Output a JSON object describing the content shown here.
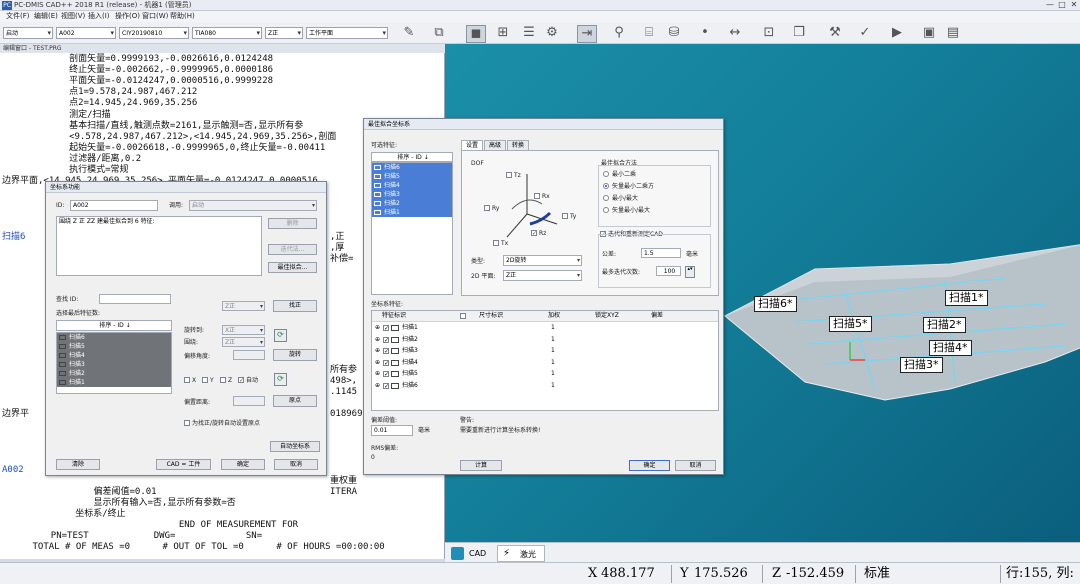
{
  "app": {
    "title": "PC-DMIS CAD++ 2018 R1 (release) - 机器1 (管理员)",
    "logo_text": "PC",
    "window_controls": [
      "—",
      "□",
      "✕"
    ]
  },
  "menu": [
    "文件(F)",
    "编辑(E)",
    "视图(V)",
    "插入(I)",
    "操作(O)",
    "窗口(W)",
    "帮助(H)"
  ],
  "toolbar": {
    "combos": [
      "启动",
      "A002",
      "CIY20190810",
      "TIA080",
      "Z正",
      "工作平面"
    ],
    "icons": [
      "probe-icon",
      "cube-wire-icon",
      "cube-solid-icon",
      "crosshair-icon",
      "comment-icon",
      "gears-icon",
      "execute-icon",
      "tree-icon",
      "cylinder-icon",
      "point-icon",
      "dimension-icon",
      "gauge-icon",
      "window-icon",
      "wrench-icon",
      "check-icon",
      "play-icon",
      "report-icon",
      "report2-icon"
    ]
  },
  "editor": {
    "caption": "编辑窗口 - TEST.PRG",
    "lines": [
      {
        "indent": 11,
        "text": "剖面矢量=0.9999193,-0.0026616,0.0124248",
        "blue": false
      },
      {
        "indent": 11,
        "text": "终止矢量=-0.002662,-0.9999965,0.0000186",
        "blue": false
      },
      {
        "indent": 11,
        "text": "平面矢量=-0.0124247,0.0000516,0.9999228",
        "blue": false
      },
      {
        "indent": 11,
        "text": "点1=9.578,24.987,467.212",
        "blue": false
      },
      {
        "indent": 11,
        "text": "点2=14.945,24.969,35.256",
        "blue": false
      },
      {
        "indent": 11,
        "text": "测定/扫描",
        "blue": false
      },
      {
        "indent": 11,
        "text": "基本扫描/直线,触测点数=2161,显示触测=否,显示所有参",
        "blue": false
      },
      {
        "indent": 11,
        "text": "<9.578,24.987,467.212>,<14.945,24.969,35.256>,剖面",
        "blue": false
      },
      {
        "indent": 11,
        "text": "起始矢量=-0.0026618,-0.9999965,0,终止矢量=-0.00411",
        "blue": false
      },
      {
        "indent": 11,
        "text": "过滤器/距离,0.2",
        "blue": false
      },
      {
        "indent": 11,
        "text": "执行模式=常规",
        "blue": false
      },
      {
        "indent": 0,
        "text": "边界平面,<14.945,24.969,35.256>,平面矢量=-0.0124247,0.0000516,",
        "blue": false
      }
    ],
    "side_labels": [
      {
        "text": "扫描6",
        "blue": true,
        "line": 16
      },
      {
        "text": "边界平",
        "blue": false,
        "line": 32
      },
      {
        "text": "A002",
        "blue": true,
        "line": 37
      }
    ],
    "right_fragments": [
      {
        "text": ",正",
        "line": 16
      },
      {
        "text": ",厚",
        "line": 17
      },
      {
        "text": "补偿=",
        "line": 18
      },
      {
        "text": "所有参",
        "line": 28
      },
      {
        "text": "498>,",
        "line": 29
      },
      {
        "text": ".1145",
        "line": 30
      },
      {
        "text": "018969",
        "line": 32
      },
      {
        "text": "重权重",
        "line": 38
      },
      {
        "text": "ITERA",
        "line": 39
      }
    ],
    "tail_lines": [
      {
        "indent": 15,
        "text": "偏差阈值=0.01"
      },
      {
        "indent": 15,
        "text": "显示所有输入=否,显示所有参数=否"
      },
      {
        "indent": 12,
        "text": "坐标系/终止"
      },
      {
        "indent": 29,
        "text": "END OF MEASUREMENT FOR"
      },
      {
        "indent": 8,
        "text": "PN=TEST            DWG=             SN="
      },
      {
        "indent": 5,
        "text": "TOTAL # OF MEAS =0      # OUT OF TOL =0      # OF HOURS =00:00:00"
      }
    ]
  },
  "viewport": {
    "labels": [
      "扫描6*",
      "扫描1*",
      "扫描5*",
      "扫描2*",
      "扫描4*",
      "扫描3*"
    ]
  },
  "bottom_tabs": [
    "CAD",
    "激光"
  ],
  "status": {
    "x_label": "X",
    "x_value": "488.177",
    "y_label": "Y",
    "y_value": "175.526",
    "z_label": "Z",
    "z_value": "-152.459",
    "mode": "标准",
    "rowcol": "行:155, 列:"
  },
  "align_dialog": {
    "title": "坐标系功能",
    "id_label": "ID:",
    "id_value": "A002",
    "recall_label": "调用:",
    "recall_value": "启动",
    "text_area": "围绕 Z 正 ZZ 建最佳拟合到 6 特征:",
    "btn_delete": "删除",
    "btn_iterate": "迭代法...",
    "btn_bestfit": "最佳拟合...",
    "find_id_label": "查找 ID:",
    "select_label": "选择最后特征数:",
    "sort_label": "排序 - ID ↓",
    "features": [
      "扫描6",
      "扫描5",
      "扫描4",
      "扫描3",
      "扫描2",
      "扫描1"
    ],
    "level_combo": "Z正",
    "level_button": "找正",
    "rotate_label": "旋转到:",
    "rotate_combo": "X正",
    "around_label": "围绕:",
    "around_combo": "Z正",
    "offset_label": "偏移角度:",
    "rotate_button": "旋转",
    "axis_labels": [
      "X",
      "Y",
      "Z"
    ],
    "auto_label": "自动",
    "offset_dist_label": "偏置距离:",
    "origin_button": "原点",
    "autoset_label": "为找正/旋转自动设置原点",
    "btn_autoalign": "自动坐标系",
    "btn_clear": "清除",
    "btn_cad": "CAD = 工件",
    "btn_ok": "确定",
    "btn_cancel": "取消"
  },
  "bestfit_dialog": {
    "title": "最佳拟合坐标系",
    "avail_label": "可选特征:",
    "sort_label": "排序 - ID ↓",
    "features": [
      "扫描6",
      "扫描5",
      "扫描4",
      "扫描3",
      "扫描2",
      "扫描1"
    ],
    "tabs": [
      "设置",
      "高级",
      "转换"
    ],
    "dof_label": "DOF",
    "dof_axes": [
      "Tz",
      "Rx",
      "Ry",
      "Ty",
      "Rz",
      "Tx"
    ],
    "type_label": "类型:",
    "type_value": "2D旋转",
    "plane_label": "2D 平面:",
    "plane_value": "Z正",
    "method_label": "最佳拟合方法",
    "methods": [
      "最小二乘",
      "矢量最小二乘方",
      "最小/最大",
      "矢量最小/最大"
    ],
    "method_selected": 1,
    "iterate_cad_label": "迭代和重新测定CAD",
    "tol_label": "公差:",
    "tol_value": "1.5",
    "tol_unit": "毫米",
    "maxiter_label": "最多迭代次数:",
    "maxiter_value": "100",
    "coord_feat_label": "坐标系特征:",
    "col_headers": [
      "特征标识",
      "尺寸标识",
      "加权",
      "锁定XYZ",
      "偏差"
    ],
    "rows": [
      {
        "name": "扫描1",
        "weight": "1"
      },
      {
        "name": "扫描2",
        "weight": "1"
      },
      {
        "name": "扫描3",
        "weight": "1"
      },
      {
        "name": "扫描4",
        "weight": "1"
      },
      {
        "name": "扫描5",
        "weight": "1"
      },
      {
        "name": "扫描6",
        "weight": "1"
      }
    ],
    "threshold_label": "偏差阈值:",
    "threshold_value": "0.01",
    "threshold_unit": "毫米",
    "warning_label": "警告:",
    "warning_text": "需要重新进行计算坐标系转换!",
    "rms_label": "RMS偏差:",
    "rms_value": "0",
    "btn_calc": "计算",
    "btn_ok": "确定",
    "btn_cancel": "取消"
  }
}
